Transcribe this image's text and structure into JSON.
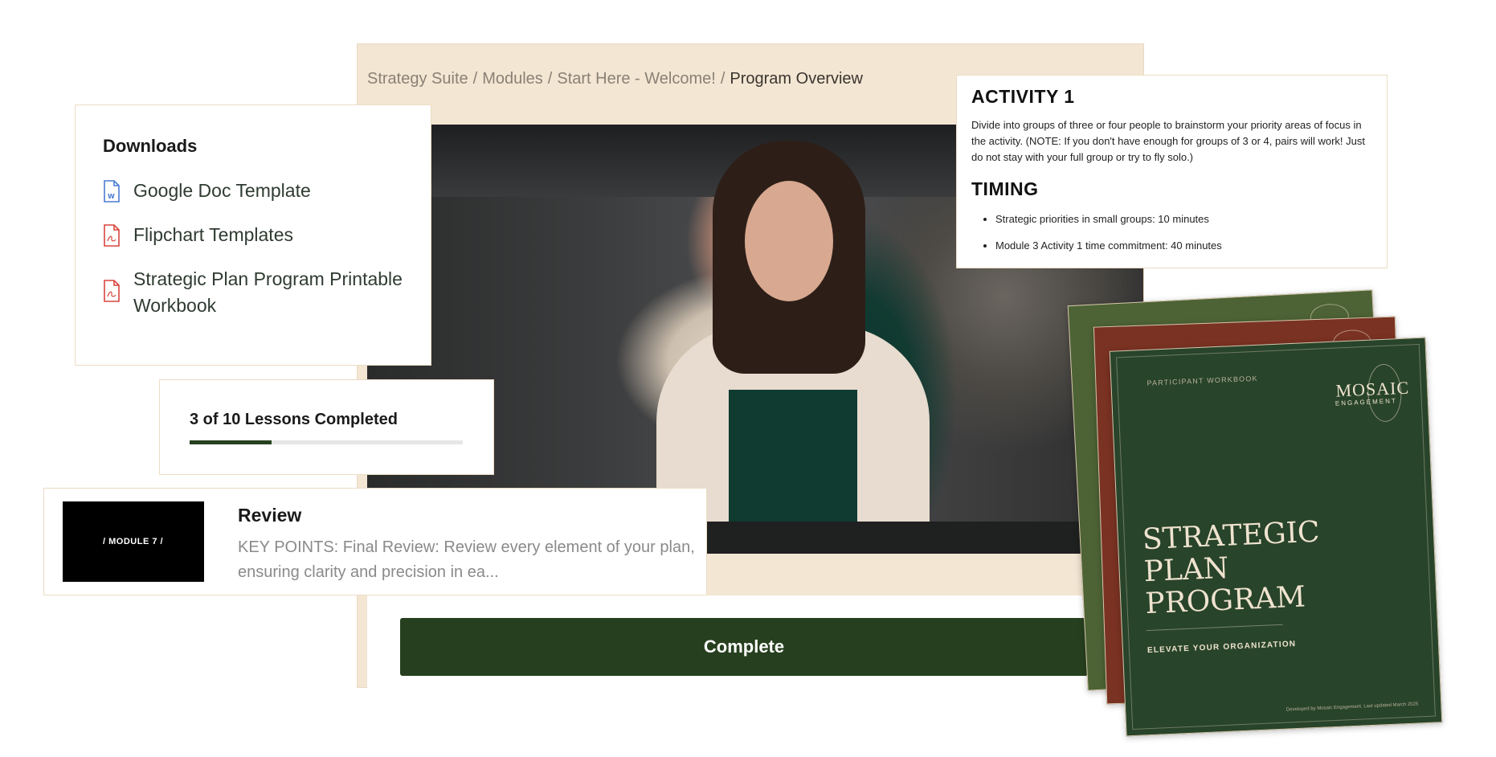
{
  "breadcrumb": {
    "items": [
      "Strategy Suite",
      "Modules",
      "Start Here - Welcome!"
    ],
    "separator": "/",
    "current": "Program Overview"
  },
  "downloads": {
    "title": "Downloads",
    "items": [
      {
        "label": "Google Doc Template",
        "icon": "word-doc-icon",
        "color": "#4a7cd4"
      },
      {
        "label": "Flipchart Templates",
        "icon": "pdf-icon",
        "color": "#d9453d"
      },
      {
        "label": "Strategic Plan Program Printable Workbook",
        "icon": "pdf-icon",
        "color": "#d9453d"
      }
    ]
  },
  "progress": {
    "label": "3 of 10 Lessons Completed",
    "completed": 3,
    "total": 10,
    "color": "#26401f"
  },
  "review": {
    "thumbnail_text": "/ MODULE 7 /",
    "title": "Review",
    "description": "KEY POINTS: Final Review: Review every element of your plan, ensuring clarity and precision in ea..."
  },
  "activity": {
    "heading": "ACTIVITY 1",
    "body": "Divide into groups of three or four people to brainstorm your priority areas of focus in the activity. (NOTE: If you don't have enough for groups of 3 or 4, pairs will work! Just do not stay with your full group or try to fly solo.)",
    "timing_heading": "TIMING",
    "timing_items": [
      "Strategic priorities in small groups: 10 minutes",
      "Module 3 Activity 1 time commitment: 40 minutes"
    ]
  },
  "complete_button": {
    "label": "Complete",
    "color": "#26401f"
  },
  "workbook": {
    "subtitle": "PARTICIPANT WORKBOOK",
    "logo": "MOSAIC",
    "logo_sub": "ENGAGEMENT",
    "title_lines": [
      "STRATEGIC",
      "PLAN",
      "PROGRAM"
    ],
    "tagline": "ELEVATE YOUR ORGANIZATION",
    "footer": "Developed by Mosaic Engagement. Last updated March 2025",
    "colors": {
      "front": "#28442a",
      "middle": "#7a3222",
      "back": "#4d6335"
    }
  }
}
